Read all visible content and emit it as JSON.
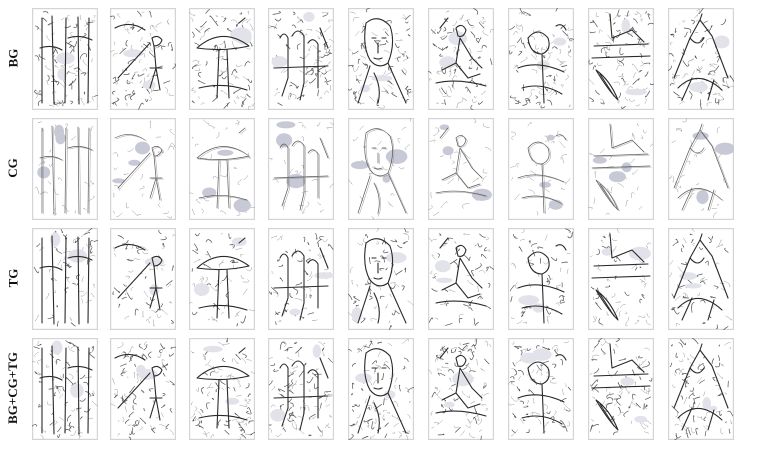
{
  "rows": [
    {
      "label": "BG",
      "style": "bg"
    },
    {
      "label": "CG",
      "style": "cg"
    },
    {
      "label": "TG",
      "style": "tg"
    },
    {
      "label": "BG+CG+TG",
      "style": "all"
    }
  ],
  "columns": [
    {
      "subject": "tree-trunks"
    },
    {
      "subject": "girl-with-umbrella-pole"
    },
    {
      "subject": "mushroom"
    },
    {
      "subject": "people-group"
    },
    {
      "subject": "face-portrait"
    },
    {
      "subject": "seated-person"
    },
    {
      "subject": "flower-bush"
    },
    {
      "subject": "boat-and-rocks"
    },
    {
      "subject": "mountain-peak"
    }
  ],
  "colors": {
    "frame": "#d4d4d8",
    "shade": "#c7c9d6",
    "ink": "#555555"
  }
}
